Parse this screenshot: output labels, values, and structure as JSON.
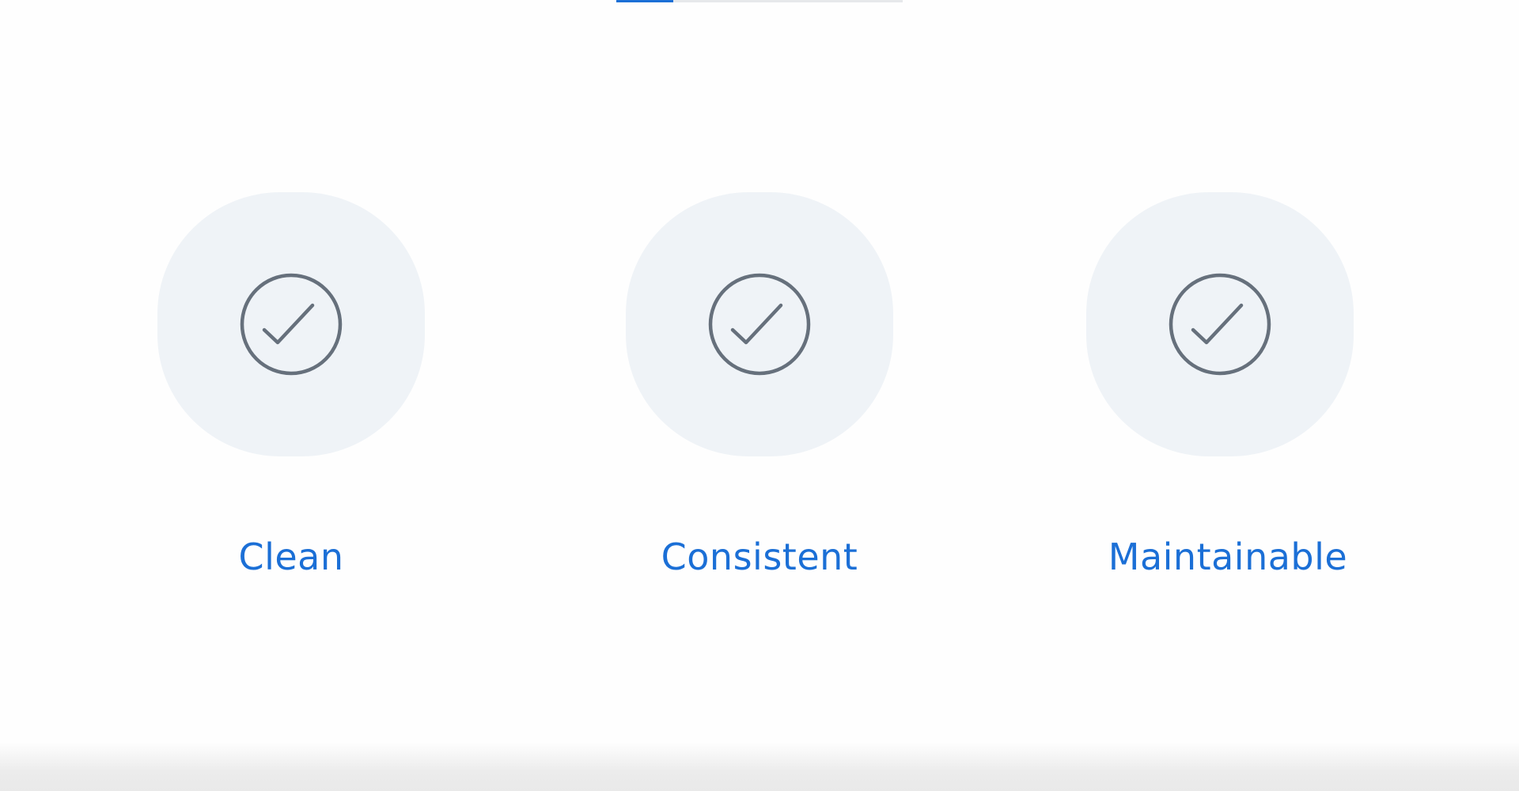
{
  "progress": {
    "fraction": 0.2,
    "accent_color": "#1b6fd6"
  },
  "features": [
    {
      "label": "Clean",
      "icon": "check-circle-icon"
    },
    {
      "label": "Consistent",
      "icon": "check-circle-icon"
    },
    {
      "label": "Maintainable",
      "icon": "check-circle-icon"
    }
  ],
  "colors": {
    "label": "#1b6fd6",
    "icon_stroke": "#66707c",
    "blob": "#eff3f7"
  }
}
